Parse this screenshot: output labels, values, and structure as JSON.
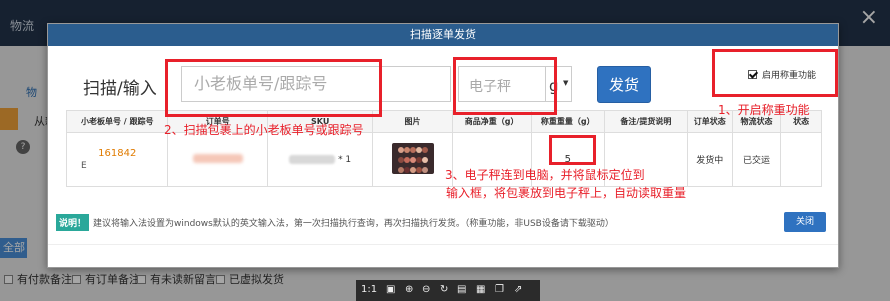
{
  "background": {
    "nav_label": "物流",
    "close_icon": "×",
    "tab_fragment": "物",
    "side_text": "从新",
    "all_button": "全部",
    "filters": [
      "有付款备注",
      "有订单备注",
      "有未读新留言",
      "已虚拟发货"
    ]
  },
  "modal": {
    "title": "扫描逐单发货",
    "scan_label": "扫描/输入",
    "scan_placeholder": "小老板单号/跟踪号",
    "scale_placeholder": "电子秤",
    "unit": "g",
    "ship_button": "发货",
    "weigh_toggle": "启用称重功能",
    "table": {
      "headers": [
        "小老板单号 / 跟踪号",
        "订单号",
        "SKU",
        "图片",
        "商品净重（g）",
        "称重重量（g）",
        "备注/提货说明",
        "订单状态",
        "物流状态",
        "状态"
      ],
      "row": {
        "order_no": "161842",
        "track_prefix": "E",
        "qty": "* 1",
        "weight": "5",
        "order_status": "发货中",
        "logistics_status": "已交运"
      }
    },
    "note_tag": "说明！",
    "note_text": "建议将输入法设置为windows默认的英文输入法，第一次扫描执行查询，再次扫描执行发货。（称重功能，非USB设备请下载驱动）",
    "close_button": "关闭"
  },
  "annotations": {
    "a1": "1、开启称重功能",
    "a2": "2、扫描包裹上的小老板单号或跟踪号",
    "a3_line1": "3、电子秤连到电脑，并将鼠标定位到",
    "a3_line2": "输入框，将包裹放到电子秤上，自动读取重量"
  },
  "viewer_toolbar": {
    "zoom_label": "1:1"
  },
  "colors": {
    "header_blue": "#2b5d8e",
    "button_blue": "#2f72c0",
    "annotation_red": "#e8202a",
    "order_orange": "#e07b00",
    "note_teal": "#2aa89a"
  }
}
